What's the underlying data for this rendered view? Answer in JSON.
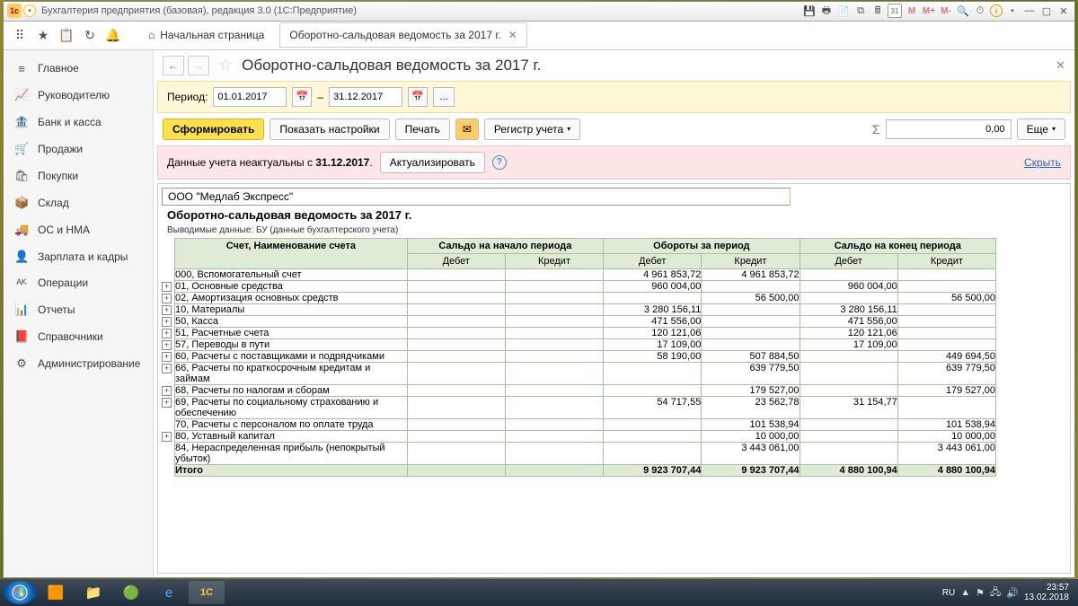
{
  "window": {
    "title": "Бухгалтерия предприятия (базовая), редакция 3.0  (1С:Предприятие)"
  },
  "toolbar": {
    "home": "Начальная страница",
    "tab": "Оборотно-сальдовая ведомость за 2017 г."
  },
  "sidebar": {
    "items": [
      {
        "icon": "≡",
        "label": "Главное"
      },
      {
        "icon": "📈",
        "label": "Руководителю"
      },
      {
        "icon": "🏦",
        "label": "Банк и касса"
      },
      {
        "icon": "🛒",
        "label": "Продажи"
      },
      {
        "icon": "🛍",
        "label": "Покупки"
      },
      {
        "icon": "📦",
        "label": "Склад"
      },
      {
        "icon": "🚚",
        "label": "ОС и НМА"
      },
      {
        "icon": "👤",
        "label": "Зарплата и кадры"
      },
      {
        "icon": "ᴬᴷ",
        "label": "Операции"
      },
      {
        "icon": "📊",
        "label": "Отчеты"
      },
      {
        "icon": "📕",
        "label": "Справочники"
      },
      {
        "icon": "⚙",
        "label": "Администрирование"
      }
    ]
  },
  "header": {
    "title": "Оборотно-сальдовая ведомость за 2017 г."
  },
  "period": {
    "label": "Период:",
    "from": "01.01.2017",
    "dash": "–",
    "to": "31.12.2017"
  },
  "actions": {
    "generate": "Сформировать",
    "settings": "Показать настройки",
    "print": "Печать",
    "register": "Регистр учета",
    "sum": "0,00",
    "more": "Еще"
  },
  "warn": {
    "text_a": "Данные учета неактуальны с ",
    "date": "31.12.2017",
    "update": "Актуализировать",
    "hide": "Скрыть"
  },
  "report": {
    "org": "ООО \"Медлаб Экспресс\"",
    "title": "Оборотно-сальдовая ведомость за 2017 г.",
    "sub": "Выводимые данные:  БУ (данные бухгалтерского учета)",
    "h_acct": "Счет, Наименование счета",
    "h_sb": "Сальдо на начало периода",
    "h_to": "Обороты за период",
    "h_se": "Сальдо на конец периода",
    "h_dt": "Дебет",
    "h_kt": "Кредит",
    "total_label": "Итого",
    "rows": [
      {
        "exp": false,
        "acct": "000, Вспомогательный счет",
        "sb_dt": "",
        "sb_kt": "",
        "to_dt": "4 961 853,72",
        "to_kt": "4 961 853,72",
        "se_dt": "",
        "se_kt": ""
      },
      {
        "exp": true,
        "acct": "01, Основные средства",
        "sb_dt": "",
        "sb_kt": "",
        "to_dt": "960 004,00",
        "to_kt": "",
        "se_dt": "960 004,00",
        "se_kt": ""
      },
      {
        "exp": true,
        "acct": "02, Амортизация основных средств",
        "sb_dt": "",
        "sb_kt": "",
        "to_dt": "",
        "to_kt": "56 500,00",
        "se_dt": "",
        "se_kt": "56 500,00"
      },
      {
        "exp": true,
        "acct": "10, Материалы",
        "sb_dt": "",
        "sb_kt": "",
        "to_dt": "3 280 156,11",
        "to_kt": "",
        "se_dt": "3 280 156,11",
        "se_kt": ""
      },
      {
        "exp": true,
        "acct": "50, Касса",
        "sb_dt": "",
        "sb_kt": "",
        "to_dt": "471 556,00",
        "to_kt": "",
        "se_dt": "471 556,00",
        "se_kt": ""
      },
      {
        "exp": true,
        "acct": "51, Расчетные счета",
        "sb_dt": "",
        "sb_kt": "",
        "to_dt": "120 121,06",
        "to_kt": "",
        "se_dt": "120 121,06",
        "se_kt": ""
      },
      {
        "exp": true,
        "acct": "57, Переводы в пути",
        "sb_dt": "",
        "sb_kt": "",
        "to_dt": "17 109,00",
        "to_kt": "",
        "se_dt": "17 109,00",
        "se_kt": ""
      },
      {
        "exp": true,
        "acct": "60, Расчеты с поставщиками и подрядчиками",
        "sb_dt": "",
        "sb_kt": "",
        "to_dt": "58 190,00",
        "to_kt": "507 884,50",
        "se_dt": "",
        "se_kt": "449 694,50"
      },
      {
        "exp": true,
        "acct": "66, Расчеты по краткосрочным кредитам и займам",
        "sb_dt": "",
        "sb_kt": "",
        "to_dt": "",
        "to_kt": "639 779,50",
        "se_dt": "",
        "se_kt": "639 779,50"
      },
      {
        "exp": true,
        "acct": "68, Расчеты по налогам и сборам",
        "sb_dt": "",
        "sb_kt": "",
        "to_dt": "",
        "to_kt": "179 527,00",
        "se_dt": "",
        "se_kt": "179 527,00"
      },
      {
        "exp": true,
        "acct": "69, Расчеты по социальному страхованию и обеспечению",
        "sb_dt": "",
        "sb_kt": "",
        "to_dt": "54 717,55",
        "to_kt": "23 562,78",
        "se_dt": "31 154,77",
        "se_kt": ""
      },
      {
        "exp": false,
        "acct": "70, Расчеты с персоналом по оплате труда",
        "sb_dt": "",
        "sb_kt": "",
        "to_dt": "",
        "to_kt": "101 538,94",
        "se_dt": "",
        "se_kt": "101 538,94"
      },
      {
        "exp": true,
        "acct": "80, Уставный капитал",
        "sb_dt": "",
        "sb_kt": "",
        "to_dt": "",
        "to_kt": "10 000,00",
        "se_dt": "",
        "se_kt": "10 000,00"
      },
      {
        "exp": false,
        "acct": "84, Нераспределенная прибыль (непокрытый убыток)",
        "sb_dt": "",
        "sb_kt": "",
        "to_dt": "",
        "to_kt": "3 443 061,00",
        "se_dt": "",
        "se_kt": "3 443 061,00"
      }
    ],
    "total": {
      "sb_dt": "",
      "sb_kt": "",
      "to_dt": "9 923 707,44",
      "to_kt": "9 923 707,44",
      "se_dt": "4 880 100,94",
      "se_kt": "4 880 100,94"
    }
  },
  "taskbar": {
    "lang": "RU",
    "time": "23:57",
    "date": "13.02.2018"
  }
}
